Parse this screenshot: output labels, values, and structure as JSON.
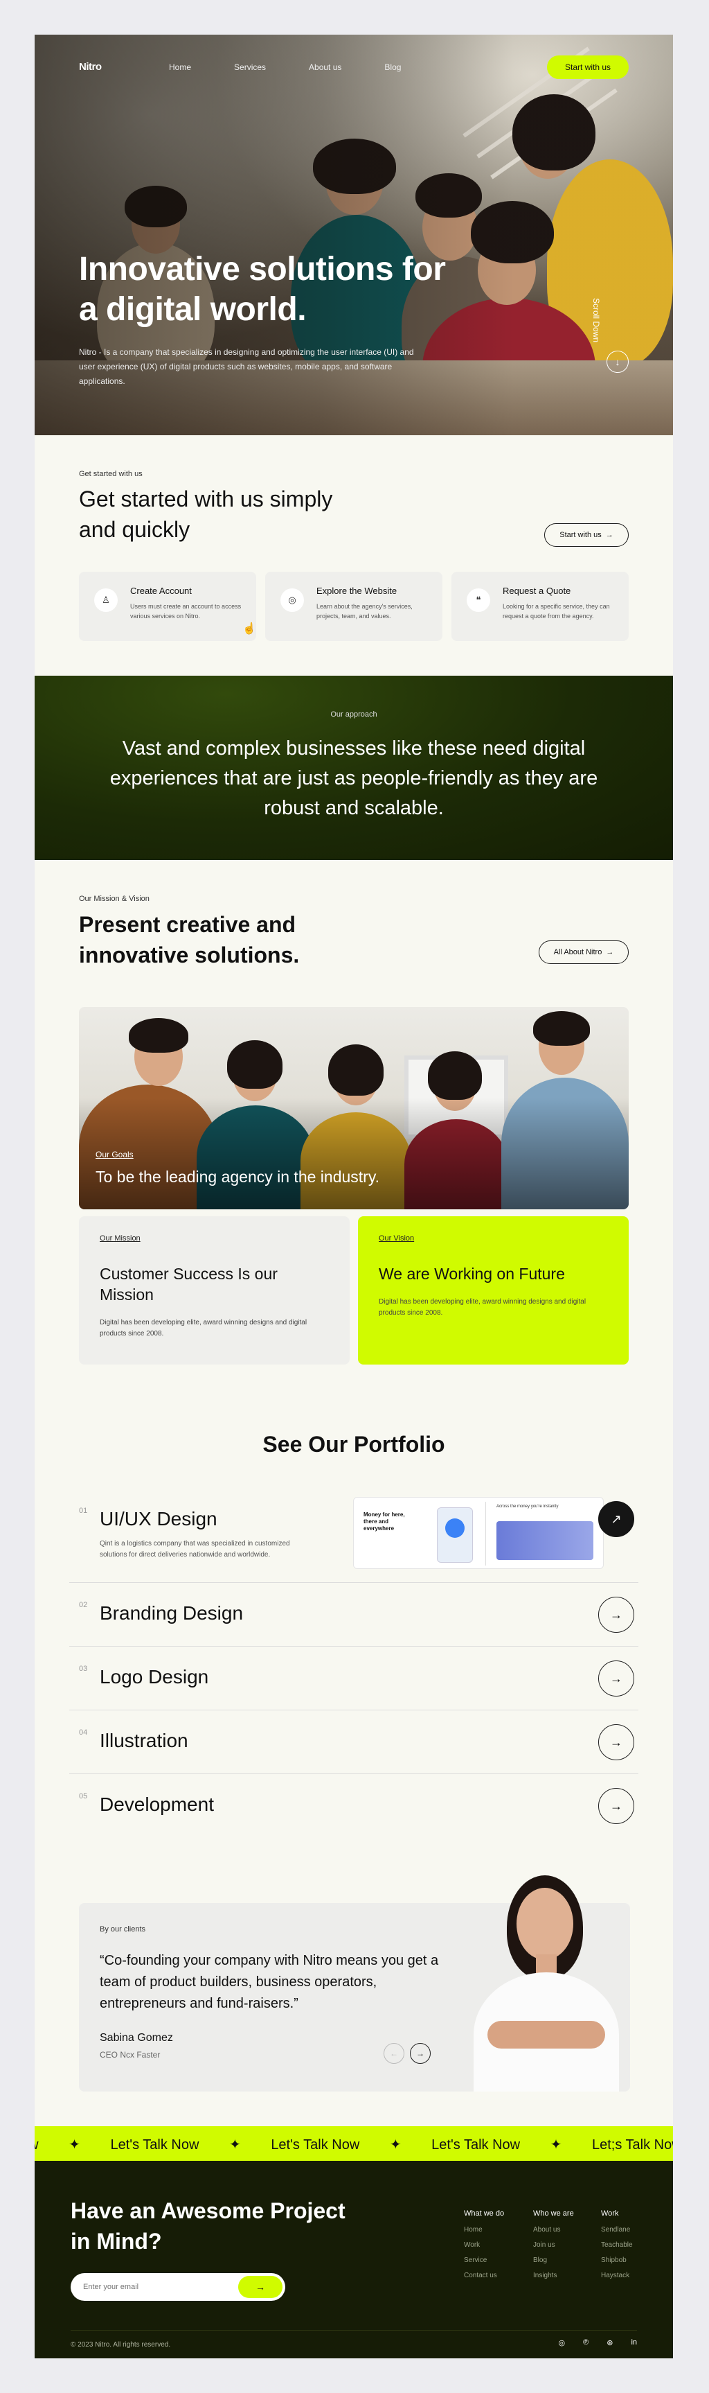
{
  "nav": {
    "logo": "Nitro",
    "links": [
      "Home",
      "Services",
      "About us",
      "Blog"
    ],
    "cta": "Start with us"
  },
  "hero": {
    "title": "Innovative solutions for a digital world.",
    "description": "Nitro - Is a company that specializes in designing and optimizing the user interface (UI) and user experience (UX) of digital products such as websites, mobile apps, and software applications.",
    "scroll_label": "Scroll Down"
  },
  "get_started": {
    "small": "Get started with us",
    "title": "Get started with us simply and quickly",
    "button": "Start with us",
    "cards": [
      {
        "title": "Create Account",
        "desc": "Users must create an account to access various services on Nitro.",
        "icon": "user-icon"
      },
      {
        "title": "Explore the Website",
        "desc": "Learn about the agency's services, projects, team, and values.",
        "icon": "compass-icon"
      },
      {
        "title": "Request a Quote",
        "desc": "Looking for a specific service, they can request a quote from the agency.",
        "icon": "quote-icon"
      }
    ]
  },
  "approach": {
    "small": "Our approach",
    "text": "Vast and complex businesses like these need digital experiences that are just as people-friendly as they are robust and scalable."
  },
  "mission_vision": {
    "small": "Our Mission & Vision",
    "title": "Present creative and innovative solutions.",
    "button": "All About Nitro",
    "goals_small": "Our Goals",
    "goals_text": "To be the leading agency in the industry.",
    "mission": {
      "label": "Our Mission",
      "title": "Customer Success Is our Mission",
      "desc": "Digital has been developing elite, award winning designs and digital products since 2008."
    },
    "vision": {
      "label": "Our Vision",
      "title": "We are Working on Future",
      "desc": "Digital has been developing elite, award winning designs and digital products since 2008."
    }
  },
  "portfolio": {
    "title": "See Our Portfolio",
    "items": [
      {
        "num": "01",
        "name": "UI/UX Design",
        "desc": "Qint is a logistics company that was specialized in customized solutions for direct deliveries nationwide and worldwide."
      },
      {
        "num": "02",
        "name": "Branding Design"
      },
      {
        "num": "03",
        "name": "Logo Design"
      },
      {
        "num": "04",
        "name": "Illustration"
      },
      {
        "num": "05",
        "name": "Development"
      }
    ],
    "preview": {
      "headline": "Money for here, there and everywhere",
      "headline2": "Across the money you're instantly"
    }
  },
  "testimonial": {
    "small": "By our clients",
    "quote": "“Co-founding your company with Nitro means you get a team of product builders, business operators, entrepreneurs and fund-raisers.”",
    "name": "Sabina Gomez",
    "role": "CEO Ncx Faster"
  },
  "ticker": [
    "ow",
    "✦",
    "Let's Talk Now",
    "✦",
    "Let's Talk Now",
    "✦",
    "Let's Talk Now",
    "✦",
    "Let;s Talk Now"
  ],
  "footer": {
    "title": "Have an Awesome Project in Mind?",
    "email_placeholder": "Enter your email",
    "columns": [
      {
        "heading": "What we do",
        "items": [
          "Home",
          "Work",
          "Service",
          "Contact us"
        ]
      },
      {
        "heading": "Who we are",
        "items": [
          "About us",
          "Join us",
          "Blog",
          "Insights"
        ]
      },
      {
        "heading": "Work",
        "items": [
          "Sendlane",
          "Teachable",
          "Shipbob",
          "Haystack"
        ]
      }
    ],
    "copyright": "© 2023 Nitro. All rights reserved.",
    "socials": [
      "instagram-icon",
      "pinterest-icon",
      "dribbble-icon",
      "linkedin-icon"
    ]
  },
  "colors": {
    "accent": "#d0fb00",
    "dark": "#161c06",
    "bg": "#f8f8f1"
  }
}
